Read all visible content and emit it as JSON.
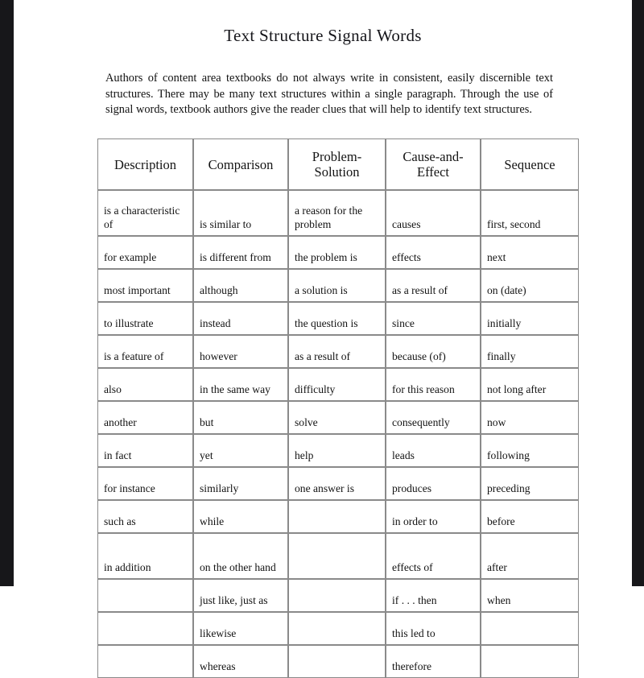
{
  "document": {
    "title": "Text Structure Signal Words",
    "intro": "Authors of content area textbooks do not always write in consistent, easily discernible text structures. There may be many text structures within a single paragraph. Through the use of signal words, textbook authors give the reader clues that will help to identify text structures.",
    "background_color": "#ffffff",
    "text_color": "#121212",
    "border_color": "#8a8a8a",
    "edge_strip_color": "#17171a"
  },
  "table": {
    "headers": [
      "Description",
      "Comparison",
      "Problem-Solution",
      "Cause-and-Effect",
      "Sequence"
    ],
    "rows": [
      [
        "is a characteristic of",
        "is similar to",
        "a reason for the problem",
        "causes",
        "first, second"
      ],
      [
        "for example",
        "is different from",
        "the problem is",
        "effects",
        "next"
      ],
      [
        "most important",
        "although",
        "a solution is",
        "as a result of",
        "on (date)"
      ],
      [
        "to illustrate",
        "instead",
        "the question is",
        "since",
        "initially"
      ],
      [
        "is a feature of",
        "however",
        "as a result of",
        "because (of)",
        "finally"
      ],
      [
        "also",
        "in the same way",
        "difficulty",
        "for this reason",
        "not long after"
      ],
      [
        "another",
        "but",
        "solve",
        "consequently",
        "now"
      ],
      [
        "in fact",
        "yet",
        "help",
        "leads",
        "following"
      ],
      [
        "for instance",
        "similarly",
        "one answer is",
        "produces",
        "preceding"
      ],
      [
        "such as",
        "while",
        "",
        "in order to",
        "before"
      ],
      [
        "in addition",
        "on the other hand",
        "",
        "effects of",
        "after"
      ],
      [
        "",
        "just like, just as",
        "",
        "if . . . then",
        "when"
      ],
      [
        "",
        "likewise",
        "",
        "this led to",
        ""
      ],
      [
        "",
        "whereas",
        "",
        "therefore",
        ""
      ]
    ],
    "tall_rows": [
      0,
      10
    ]
  }
}
